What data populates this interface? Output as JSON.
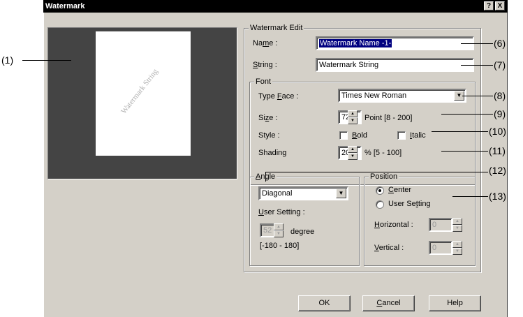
{
  "dialog": {
    "title": "Watermark",
    "help_icon": "?",
    "close_icon": "X"
  },
  "preview": {
    "watermark_text": "Watermark String"
  },
  "edit": {
    "legend": "Watermark Edit",
    "name_label_pre": "Na",
    "name_label_u": "m",
    "name_label_post": "e :",
    "name_value": "Watermark Name -1-",
    "string_label_u": "S",
    "string_label_post": "tring :",
    "string_value": "Watermark String"
  },
  "font": {
    "legend": "Font",
    "typeface_label_pre": "Type ",
    "typeface_label_u": "F",
    "typeface_label_post": "ace :",
    "typeface_value": "Times New Roman",
    "size_label_pre": "Si",
    "size_label_u": "z",
    "size_label_post": "e :",
    "size_value": "72",
    "size_unit": "Point [8 - 200]",
    "style_label": "Style :",
    "bold_u": "B",
    "bold_rest": "old",
    "bold_checked": false,
    "italic_u": "I",
    "italic_rest": "talic",
    "italic_checked": false,
    "shading_label_pre": "Shadin",
    "shading_label_u": "g",
    "shading_value": "20",
    "shading_unit": "%   [5 - 100]"
  },
  "angle": {
    "legend_u": "A",
    "legend_rest": "ngle",
    "mode_value": "Diagonal",
    "user_setting_u": "U",
    "user_setting_rest": "ser Setting :",
    "degree_value": "52",
    "degree_label": "degree",
    "range": "[-180 - 180]"
  },
  "position": {
    "legend": "Position",
    "center_u": "C",
    "center_rest": "enter",
    "center_selected": true,
    "user_pre": "User Se",
    "user_u": "t",
    "user_post": "ting",
    "user_selected": false,
    "horizontal_u": "H",
    "horizontal_rest": "orizontal :",
    "horizontal_value": "0",
    "vertical_u": "V",
    "vertical_rest": "ertical :",
    "vertical_value": "0"
  },
  "buttons": {
    "ok": "OK",
    "cancel_u": "C",
    "cancel_rest": "ancel",
    "help": "Help"
  },
  "callouts": [
    "(1)",
    "(6)",
    "(7)",
    "(8)",
    "(9)",
    "(10)",
    "(11)",
    "(12)",
    "(13)"
  ]
}
